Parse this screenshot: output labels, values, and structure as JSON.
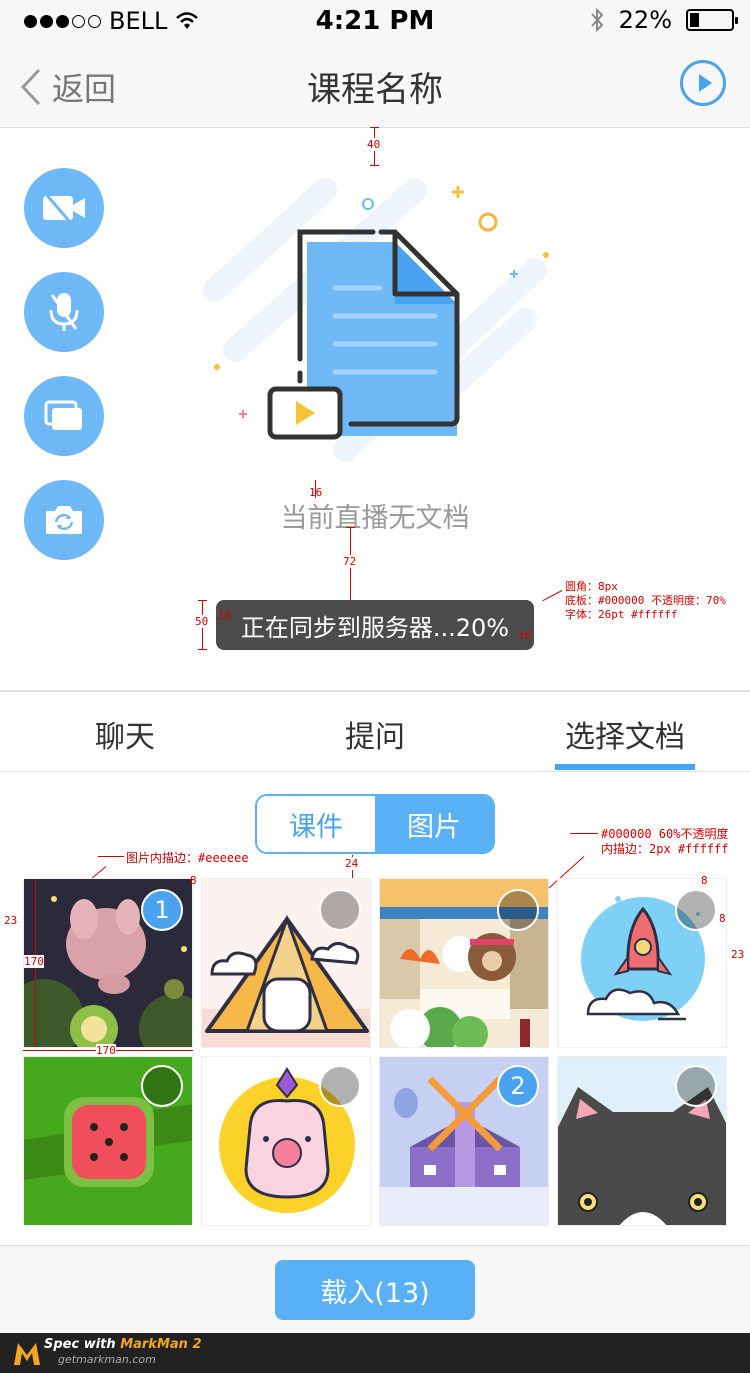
{
  "status": {
    "carrier": "BELL",
    "time": "4:21 PM",
    "battery": "22%",
    "battery_level": 0.22
  },
  "nav": {
    "back_label": "返回",
    "title": "课程名称"
  },
  "side_buttons": [
    {
      "icon": "video-off-icon"
    },
    {
      "icon": "mic-off-icon"
    },
    {
      "icon": "windows-icon"
    },
    {
      "icon": "camera-switch-icon"
    }
  ],
  "main": {
    "empty_text": "当前直播无文档",
    "toast": "正在同步到服务器...20%"
  },
  "annotations": {
    "d40": "40",
    "d16a": "16",
    "d72": "72",
    "d50": "50",
    "d16b": "16",
    "d16c": "16",
    "toast_spec_1": "圆角：8px",
    "toast_spec_2": "底板：#000000 不透明度：70%",
    "toast_spec_3": "字体：26pt #ffffff",
    "img_border": "图片内描边：#eeeeee",
    "sel_spec_1": "#000000 60%不透明度",
    "sel_spec_2": "内描边：2px #ffffff",
    "d8a": "8",
    "d24": "24",
    "d8b": "8",
    "d8c": "8",
    "d23a": "23",
    "d23b": "23",
    "d170a": "170",
    "d170b": "170"
  },
  "tabs": {
    "chat": "聊天",
    "question": "提问",
    "select_doc": "选择文档"
  },
  "segment": {
    "courseware": "课件",
    "images": "图片"
  },
  "images": [
    {
      "name": "rabbit-night-image",
      "badge": "1"
    },
    {
      "name": "pyramid-image",
      "badge": ""
    },
    {
      "name": "bear-kitchen-image",
      "badge": ""
    },
    {
      "name": "rocket-image",
      "badge": ""
    },
    {
      "name": "watermelon-image",
      "badge": ""
    },
    {
      "name": "pig-character-image",
      "badge": ""
    },
    {
      "name": "windmill-image",
      "badge": "2"
    },
    {
      "name": "cat-image",
      "badge": ""
    }
  ],
  "load_button": "载入(13)",
  "footer": {
    "brand_prefix": "Spec with ",
    "brand": "MarkMan 2",
    "url": "getmarkman.com"
  },
  "colors": {
    "accent": "#4aa3f0",
    "light_accent": "#6fb8f6",
    "toast_bg": "#000000b3"
  }
}
